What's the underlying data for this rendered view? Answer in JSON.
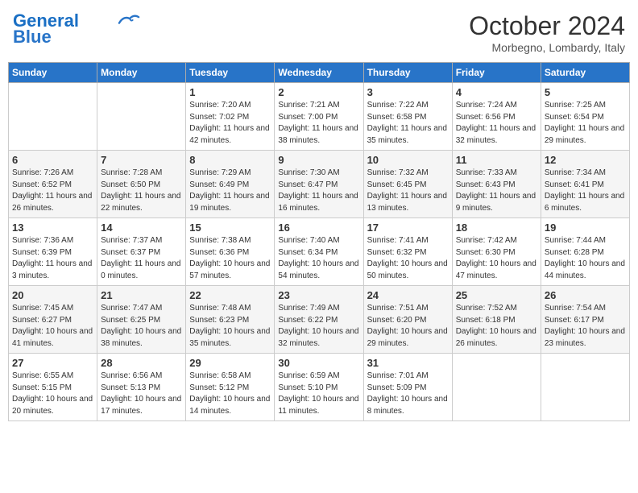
{
  "header": {
    "logo_line1": "General",
    "logo_line2": "Blue",
    "month": "October 2024",
    "location": "Morbegno, Lombardy, Italy"
  },
  "days_of_week": [
    "Sunday",
    "Monday",
    "Tuesday",
    "Wednesday",
    "Thursday",
    "Friday",
    "Saturday"
  ],
  "weeks": [
    [
      {
        "day": null
      },
      {
        "day": null
      },
      {
        "day": "1",
        "sunrise": "7:20 AM",
        "sunset": "7:02 PM",
        "daylight": "11 hours and 42 minutes."
      },
      {
        "day": "2",
        "sunrise": "7:21 AM",
        "sunset": "7:00 PM",
        "daylight": "11 hours and 38 minutes."
      },
      {
        "day": "3",
        "sunrise": "7:22 AM",
        "sunset": "6:58 PM",
        "daylight": "11 hours and 35 minutes."
      },
      {
        "day": "4",
        "sunrise": "7:24 AM",
        "sunset": "6:56 PM",
        "daylight": "11 hours and 32 minutes."
      },
      {
        "day": "5",
        "sunrise": "7:25 AM",
        "sunset": "6:54 PM",
        "daylight": "11 hours and 29 minutes."
      }
    ],
    [
      {
        "day": "6",
        "sunrise": "7:26 AM",
        "sunset": "6:52 PM",
        "daylight": "11 hours and 26 minutes."
      },
      {
        "day": "7",
        "sunrise": "7:28 AM",
        "sunset": "6:50 PM",
        "daylight": "11 hours and 22 minutes."
      },
      {
        "day": "8",
        "sunrise": "7:29 AM",
        "sunset": "6:49 PM",
        "daylight": "11 hours and 19 minutes."
      },
      {
        "day": "9",
        "sunrise": "7:30 AM",
        "sunset": "6:47 PM",
        "daylight": "11 hours and 16 minutes."
      },
      {
        "day": "10",
        "sunrise": "7:32 AM",
        "sunset": "6:45 PM",
        "daylight": "11 hours and 13 minutes."
      },
      {
        "day": "11",
        "sunrise": "7:33 AM",
        "sunset": "6:43 PM",
        "daylight": "11 hours and 9 minutes."
      },
      {
        "day": "12",
        "sunrise": "7:34 AM",
        "sunset": "6:41 PM",
        "daylight": "11 hours and 6 minutes."
      }
    ],
    [
      {
        "day": "13",
        "sunrise": "7:36 AM",
        "sunset": "6:39 PM",
        "daylight": "11 hours and 3 minutes."
      },
      {
        "day": "14",
        "sunrise": "7:37 AM",
        "sunset": "6:37 PM",
        "daylight": "11 hours and 0 minutes."
      },
      {
        "day": "15",
        "sunrise": "7:38 AM",
        "sunset": "6:36 PM",
        "daylight": "10 hours and 57 minutes."
      },
      {
        "day": "16",
        "sunrise": "7:40 AM",
        "sunset": "6:34 PM",
        "daylight": "10 hours and 54 minutes."
      },
      {
        "day": "17",
        "sunrise": "7:41 AM",
        "sunset": "6:32 PM",
        "daylight": "10 hours and 50 minutes."
      },
      {
        "day": "18",
        "sunrise": "7:42 AM",
        "sunset": "6:30 PM",
        "daylight": "10 hours and 47 minutes."
      },
      {
        "day": "19",
        "sunrise": "7:44 AM",
        "sunset": "6:28 PM",
        "daylight": "10 hours and 44 minutes."
      }
    ],
    [
      {
        "day": "20",
        "sunrise": "7:45 AM",
        "sunset": "6:27 PM",
        "daylight": "10 hours and 41 minutes."
      },
      {
        "day": "21",
        "sunrise": "7:47 AM",
        "sunset": "6:25 PM",
        "daylight": "10 hours and 38 minutes."
      },
      {
        "day": "22",
        "sunrise": "7:48 AM",
        "sunset": "6:23 PM",
        "daylight": "10 hours and 35 minutes."
      },
      {
        "day": "23",
        "sunrise": "7:49 AM",
        "sunset": "6:22 PM",
        "daylight": "10 hours and 32 minutes."
      },
      {
        "day": "24",
        "sunrise": "7:51 AM",
        "sunset": "6:20 PM",
        "daylight": "10 hours and 29 minutes."
      },
      {
        "day": "25",
        "sunrise": "7:52 AM",
        "sunset": "6:18 PM",
        "daylight": "10 hours and 26 minutes."
      },
      {
        "day": "26",
        "sunrise": "7:54 AM",
        "sunset": "6:17 PM",
        "daylight": "10 hours and 23 minutes."
      }
    ],
    [
      {
        "day": "27",
        "sunrise": "6:55 AM",
        "sunset": "5:15 PM",
        "daylight": "10 hours and 20 minutes."
      },
      {
        "day": "28",
        "sunrise": "6:56 AM",
        "sunset": "5:13 PM",
        "daylight": "10 hours and 17 minutes."
      },
      {
        "day": "29",
        "sunrise": "6:58 AM",
        "sunset": "5:12 PM",
        "daylight": "10 hours and 14 minutes."
      },
      {
        "day": "30",
        "sunrise": "6:59 AM",
        "sunset": "5:10 PM",
        "daylight": "10 hours and 11 minutes."
      },
      {
        "day": "31",
        "sunrise": "7:01 AM",
        "sunset": "5:09 PM",
        "daylight": "10 hours and 8 minutes."
      },
      {
        "day": null
      },
      {
        "day": null
      }
    ]
  ],
  "labels": {
    "sunrise_prefix": "Sunrise: ",
    "sunset_prefix": "Sunset: ",
    "daylight_prefix": "Daylight: "
  }
}
